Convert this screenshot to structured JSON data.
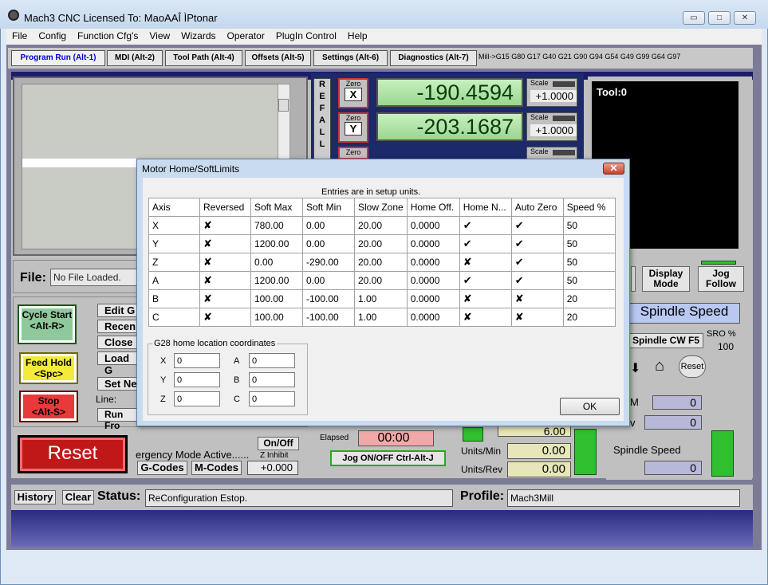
{
  "window": {
    "title": "Mach3 CNC  Licensed To: MaoAAÎ ÌPtonar",
    "min_label": "▭",
    "max_label": "□",
    "close_label": "✕"
  },
  "menu": [
    "File",
    "Config",
    "Function Cfg's",
    "View",
    "Wizards",
    "Operator",
    "PlugIn Control",
    "Help"
  ],
  "tabs": [
    "Program Run (Alt-1)",
    "MDI (Alt-2)",
    "Tool Path (Alt-4)",
    "Offsets (Alt-5)",
    "Settings (Alt-6)",
    "Diagnostics (Alt-7)"
  ],
  "gcode_line": "Mill->G15  G80 G17 G40 G21 G90 G94 G54 G49 G99 G64 G97",
  "refall": "REFALL",
  "axes": [
    {
      "zero_label": "Zero",
      "axis": "X",
      "value": "-190.4594",
      "scale_label": "Scale",
      "scale": "+1.0000"
    },
    {
      "zero_label": "Zero",
      "axis": "Y",
      "value": "-203.1687",
      "scale_label": "Scale",
      "scale": "+1.0000"
    },
    {
      "zero_label": "Zero",
      "axis": "",
      "value": "",
      "scale_label": "Scale",
      "scale": ""
    }
  ],
  "tool_display": "Tool:0",
  "file": {
    "label": "File:",
    "value": "No File Loaded."
  },
  "controls": {
    "cycle_start": "Cycle Start",
    "cycle_start_key": "<Alt-R>",
    "feed_hold": "Feed Hold",
    "feed_hold_key": "<Spc>",
    "stop": "Stop",
    "stop_key": "<Alt-S>",
    "edit": "Edit G",
    "recent": "Recen",
    "close": "Close",
    "load": "Load G",
    "set_next": "Set Ne",
    "line_label": "Line:",
    "run_from": "Run Fro"
  },
  "reset": {
    "label": "Reset",
    "emergency": "ergency Mode Active......",
    "gcodes": "G-Codes",
    "mcodes": "M-Codes",
    "onoff": "On/Off",
    "z_inhibit": "Z Inhibit",
    "z_value": "+0.000"
  },
  "elapsed": {
    "label": "Elapsed",
    "value": "00:00",
    "jog": "Jog ON/OFF Ctrl-Alt-J"
  },
  "feed": {
    "top_value": "6.00",
    "units_min_label": "Units/Min",
    "units_min": "0.00",
    "units_rev_label": "Units/Rev",
    "units_rev": "0.00"
  },
  "display_mode": "Display Mode",
  "jog_follow": "Jog Follow",
  "spindle": {
    "header": "Spindle Speed",
    "cw": "Spindle CW F5",
    "sro_label": "SRO %",
    "sro": "100",
    "reset": "Reset",
    "rpm_label": "M",
    "rpm": "0",
    "sov_label": "v",
    "sov": "0",
    "speed_label": "Spindle Speed",
    "speed": "0"
  },
  "status": {
    "history": "History",
    "clear": "Clear",
    "label": "Status:",
    "value": "ReConfiguration Estop.",
    "profile_label": "Profile:",
    "profile": "Mach3Mill"
  },
  "dialog": {
    "title": "Motor Home/SoftLimits",
    "close_label": "✕",
    "note": "Entries are in setup units.",
    "columns": [
      "Axis",
      "Reversed",
      "Soft Max",
      "Soft Min",
      "Slow Zone",
      "Home Off.",
      "Home N...",
      "Auto Zero",
      "Speed %"
    ],
    "rows": [
      {
        "axis": "X",
        "reversed": "✘",
        "soft_max": "780.00",
        "soft_min": "0.00",
        "slow_zone": "20.00",
        "home_off": "0.0000",
        "home_neg": "✔",
        "auto_zero": "✔",
        "speed": "50"
      },
      {
        "axis": "Y",
        "reversed": "✘",
        "soft_max": "1200.00",
        "soft_min": "0.00",
        "slow_zone": "20.00",
        "home_off": "0.0000",
        "home_neg": "✔",
        "auto_zero": "✔",
        "speed": "50"
      },
      {
        "axis": "Z",
        "reversed": "✘",
        "soft_max": "0.00",
        "soft_min": "-290.00",
        "slow_zone": "20.00",
        "home_off": "0.0000",
        "home_neg": "✘",
        "auto_zero": "✔",
        "speed": "50"
      },
      {
        "axis": "A",
        "reversed": "✘",
        "soft_max": "1200.00",
        "soft_min": "0.00",
        "slow_zone": "20.00",
        "home_off": "0.0000",
        "home_neg": "✔",
        "auto_zero": "✔",
        "speed": "50"
      },
      {
        "axis": "B",
        "reversed": "✘",
        "soft_max": "100.00",
        "soft_min": "-100.00",
        "slow_zone": "1.00",
        "home_off": "0.0000",
        "home_neg": "✘",
        "auto_zero": "✘",
        "speed": "20"
      },
      {
        "axis": "C",
        "reversed": "✘",
        "soft_max": "100.00",
        "soft_min": "-100.00",
        "slow_zone": "1.00",
        "home_off": "0.0000",
        "home_neg": "✘",
        "auto_zero": "✘",
        "speed": "20"
      }
    ],
    "g28": {
      "title": "G28 home location coordinates",
      "x_label": "X",
      "x": "0",
      "y_label": "Y",
      "y": "0",
      "z_label": "Z",
      "z": "0",
      "a_label": "A",
      "a": "0",
      "b_label": "B",
      "b": "0",
      "c_label": "C",
      "c": "0"
    },
    "ok": "OK"
  }
}
